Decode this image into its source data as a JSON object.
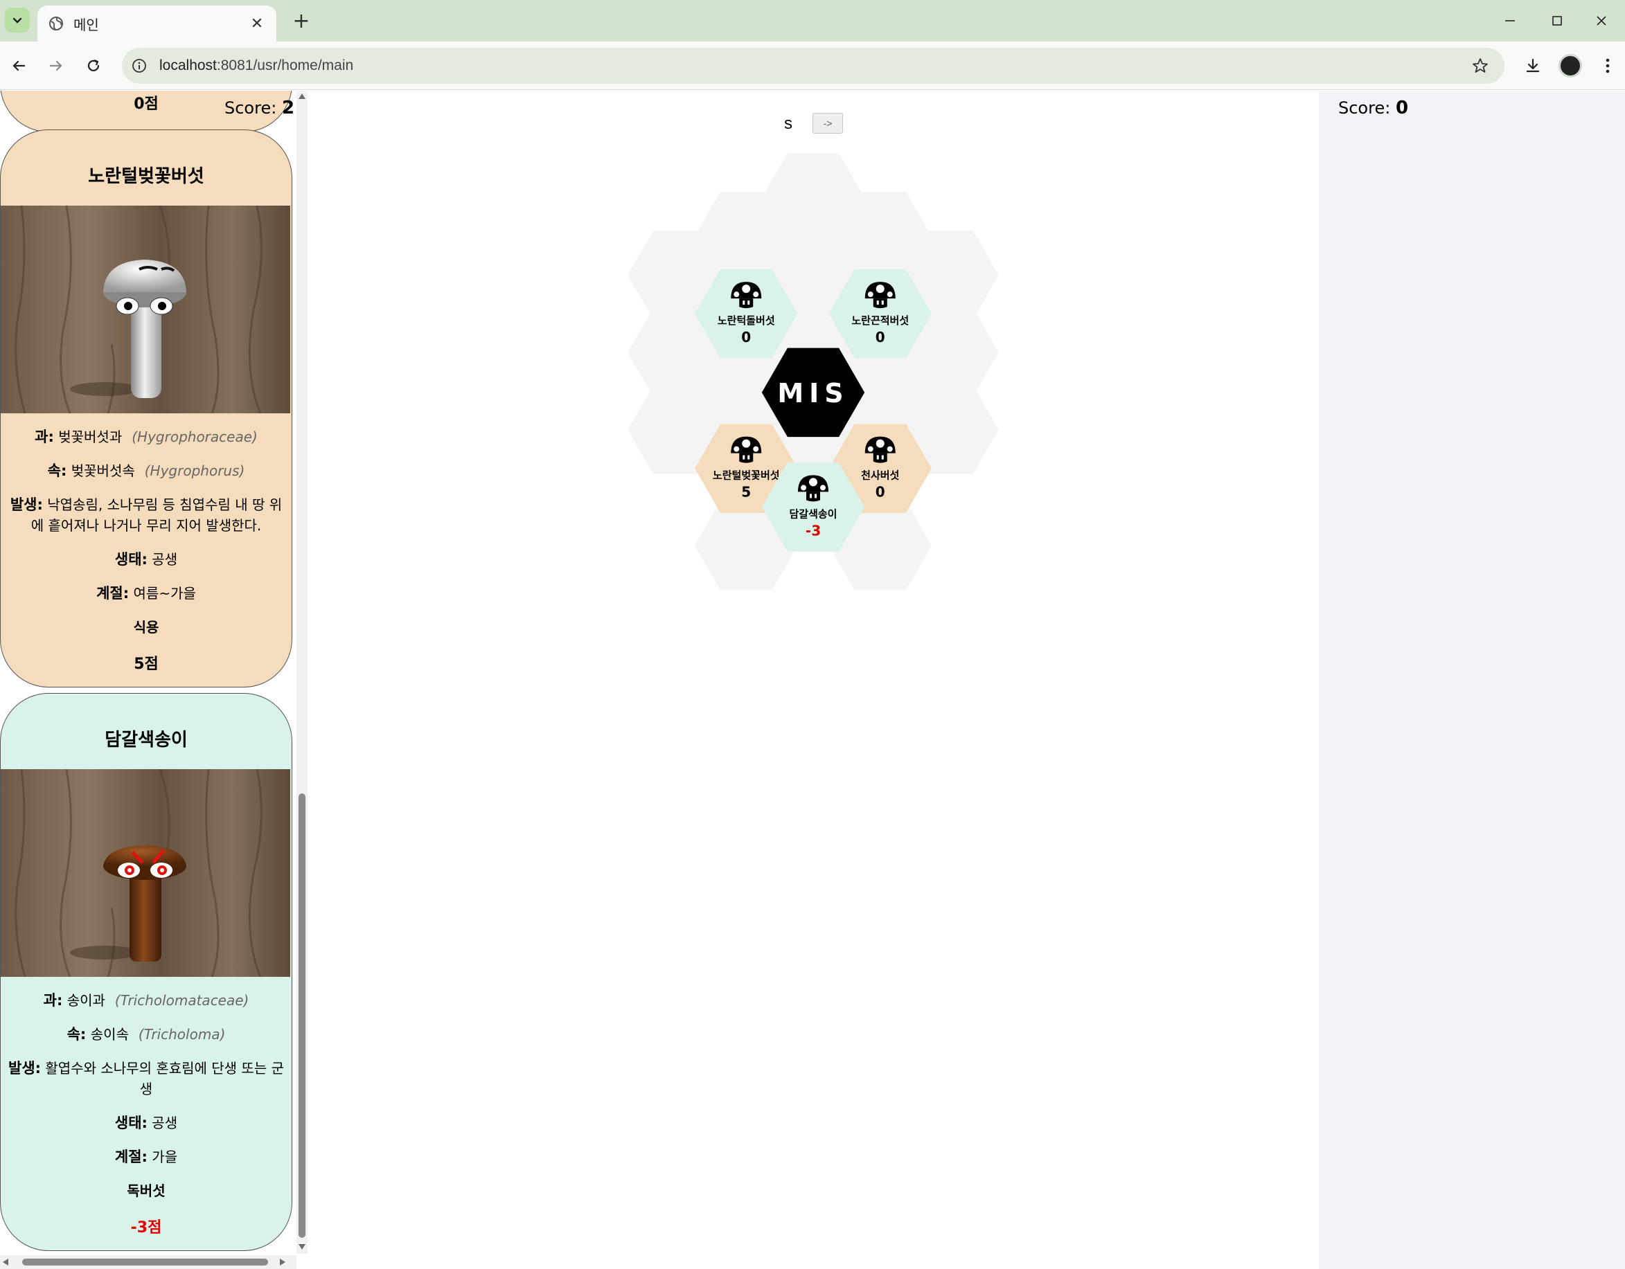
{
  "browser": {
    "tab_title": "메인",
    "url_host": "localhost",
    "url_path": ":8081/usr/home/main"
  },
  "left_panel": {
    "prev_card_score": "0점",
    "score_label": "Score:",
    "score_value": "2",
    "cards": [
      {
        "name": "노란털벚꽃버섯",
        "family_label": "과:",
        "family": "벚꽃버섯과",
        "family_latin": "(Hygrophoraceae)",
        "genus_label": "속:",
        "genus": "벚꽃버섯속",
        "genus_latin": "(Hygrophorus)",
        "occurrence_label": "발생:",
        "occurrence": "낙엽송림, 소나무림 등 침엽수림 내 땅 위에 흩어져나 나거나 무리 지어 발생한다.",
        "ecology_label": "생태:",
        "ecology": "공생",
        "season_label": "계절:",
        "season": "여름~가을",
        "edibility": "식용",
        "score": "5점"
      },
      {
        "name": "담갈색송이",
        "family_label": "과:",
        "family": "송이과",
        "family_latin": "(Tricholomataceae)",
        "genus_label": "속:",
        "genus": "송이속",
        "genus_latin": "(Tricholoma)",
        "occurrence_label": "발생:",
        "occurrence": "활엽수와 소나무의 혼효림에 단생 또는 군생",
        "ecology_label": "생태:",
        "ecology": "공생",
        "season_label": "계절:",
        "season": "가을",
        "edibility": "독버섯",
        "score": "-3점"
      }
    ]
  },
  "center": {
    "s_label": "s",
    "arrow_button": "->",
    "center_logo": "MIS",
    "hex_cells": [
      {
        "name": "노란턱돌버섯",
        "value": "0",
        "type": "poison"
      },
      {
        "name": "노란끈적버섯",
        "value": "0",
        "type": "poison"
      },
      {
        "name": "노란털벚꽃버섯",
        "value": "5",
        "type": "edible"
      },
      {
        "name": "천사버섯",
        "value": "0",
        "type": "edible"
      },
      {
        "name": "담갈색송이",
        "value": "-3",
        "type": "poison"
      }
    ]
  },
  "right_panel": {
    "score_label": "Score:",
    "score_value": "0"
  },
  "colors": {
    "edible": "#f5dcbc",
    "poison": "#daf3ea",
    "board_bg": "#f4f4f4",
    "negative": "#e00000"
  }
}
